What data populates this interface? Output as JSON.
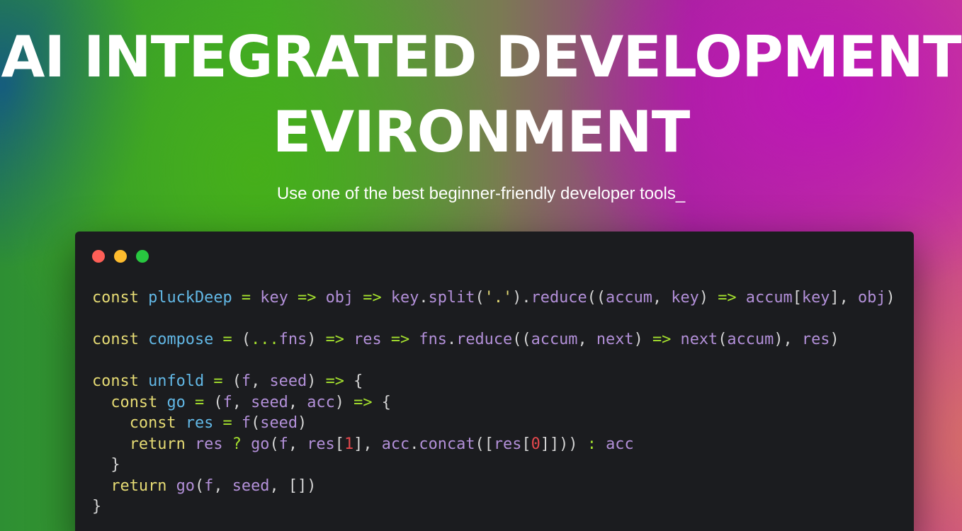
{
  "hero": {
    "title_line_1": "AI INTEGRATED DEVELOPMENT",
    "title_line_2": "EVIRONMENT",
    "subtitle": "Use one of the best beginner-friendly developer tools_"
  },
  "code_window": {
    "controls": [
      "close",
      "minimize",
      "zoom"
    ],
    "colors": {
      "close": "#fe5f57",
      "minimize": "#febc2e",
      "zoom": "#28c840",
      "background": "#1b1c1f"
    },
    "lines": [
      "const pluckDeep = key => obj => key.split('.').reduce((accum, key) => accum[key], obj)",
      "",
      "const compose = (...fns) => res => fns.reduce((accum, next) => next(accum), res)",
      "",
      "const unfold = (f, seed) => {",
      "  const go = (f, seed, acc) => {",
      "    const res = f(seed)",
      "    return res ? go(f, res[1], acc.concat([res[0]])) : acc",
      "  }",
      "  return go(f, seed, [])",
      "}"
    ]
  }
}
